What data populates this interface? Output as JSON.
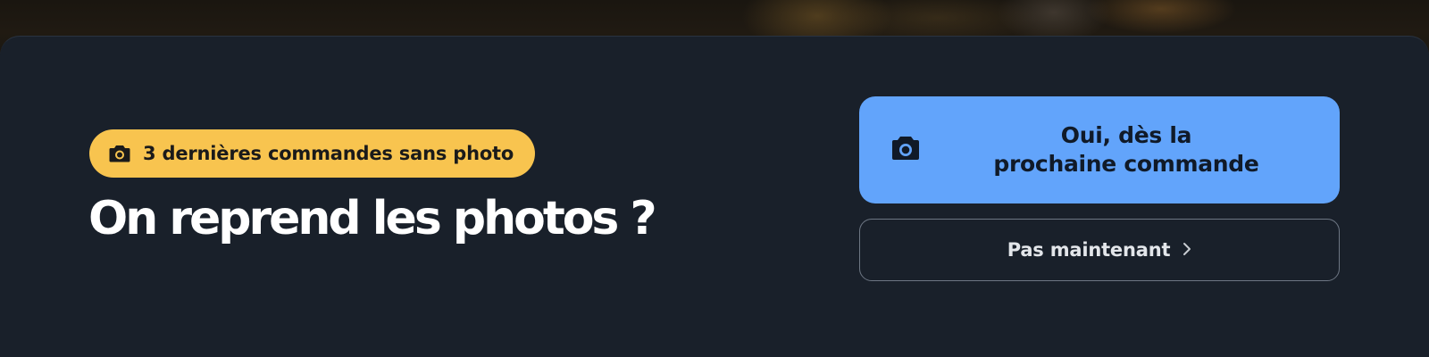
{
  "badge": {
    "icon": "camera-icon",
    "text": "3 dernières commandes sans photo",
    "color": "#f8c44f"
  },
  "title": "On reprend les photos ?",
  "primary_button": {
    "icon": "camera-icon",
    "label": "Oui, dès la\nprochaine commande",
    "color": "#62a4fb"
  },
  "secondary_button": {
    "label": "Pas maintenant",
    "icon": "chevron-right-icon"
  },
  "colors": {
    "sheet_background": "#19202a",
    "title_text": "#ffffff"
  }
}
